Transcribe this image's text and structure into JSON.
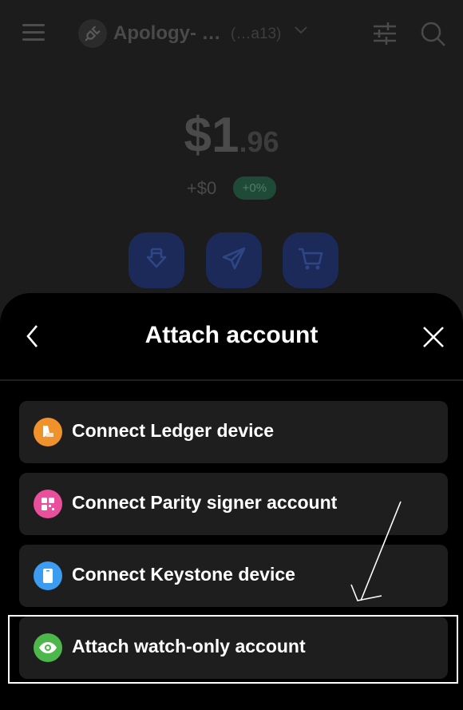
{
  "header": {
    "account_name": "Apology- …",
    "account_address": "(…a13)",
    "icons": [
      "menu-icon",
      "plug-icon",
      "chevron-down-icon",
      "sliders-icon",
      "search-icon"
    ]
  },
  "balance": {
    "main": "$1",
    "cents": ".96",
    "change": "+$0",
    "change_percent": "+0%"
  },
  "actions": [
    {
      "name": "receive",
      "icon": "receive-icon"
    },
    {
      "name": "send",
      "icon": "send-icon"
    },
    {
      "name": "buy",
      "icon": "cart-icon"
    }
  ],
  "sheet": {
    "title": "Attach account",
    "options": [
      {
        "label": "Connect Ledger device",
        "icon": "ledger-icon",
        "color": "#f0922b"
      },
      {
        "label": "Connect Parity signer account",
        "icon": "qr-icon",
        "color": "#e94f9a"
      },
      {
        "label": "Connect Keystone device",
        "icon": "keystone-icon",
        "color": "#3b9cf0"
      },
      {
        "label": "Attach watch-only account",
        "icon": "eye-icon",
        "color": "#4cb84c"
      }
    ]
  },
  "colors": {
    "background": "#1c1c1c",
    "sheet": "#000000",
    "option_bg": "#1e1e1e",
    "action_bg": "#1b2a58",
    "badge_bg": "#1f4a38"
  }
}
